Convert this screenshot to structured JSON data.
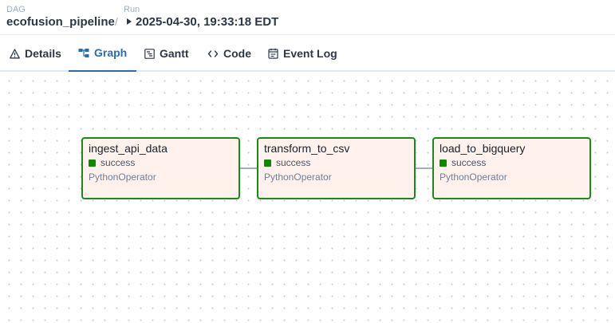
{
  "breadcrumb": {
    "dag_label": "DAG",
    "dag_value": "ecofusion_pipeline",
    "separator": "/",
    "run_label": "Run",
    "run_value": "2025-04-30, 19:33:18 EDT"
  },
  "tabs": [
    {
      "label": "Details",
      "icon": "warning-triangle-icon"
    },
    {
      "label": "Graph",
      "icon": "graph-icon",
      "active": true
    },
    {
      "label": "Gantt",
      "icon": "gantt-icon"
    },
    {
      "label": "Code",
      "icon": "code-icon"
    },
    {
      "label": "Event Log",
      "icon": "event-log-icon"
    }
  ],
  "nodes": [
    {
      "id": "ingest_api_data",
      "status": "success",
      "operator": "PythonOperator"
    },
    {
      "id": "transform_to_csv",
      "status": "success",
      "operator": "PythonOperator"
    },
    {
      "id": "load_to_bigquery",
      "status": "success",
      "operator": "PythonOperator"
    }
  ],
  "colors": {
    "success": "#0b8a00",
    "node_border": "#188a1a",
    "node_fill": "#fff1ec",
    "active_tab": "#2b6cb0"
  }
}
